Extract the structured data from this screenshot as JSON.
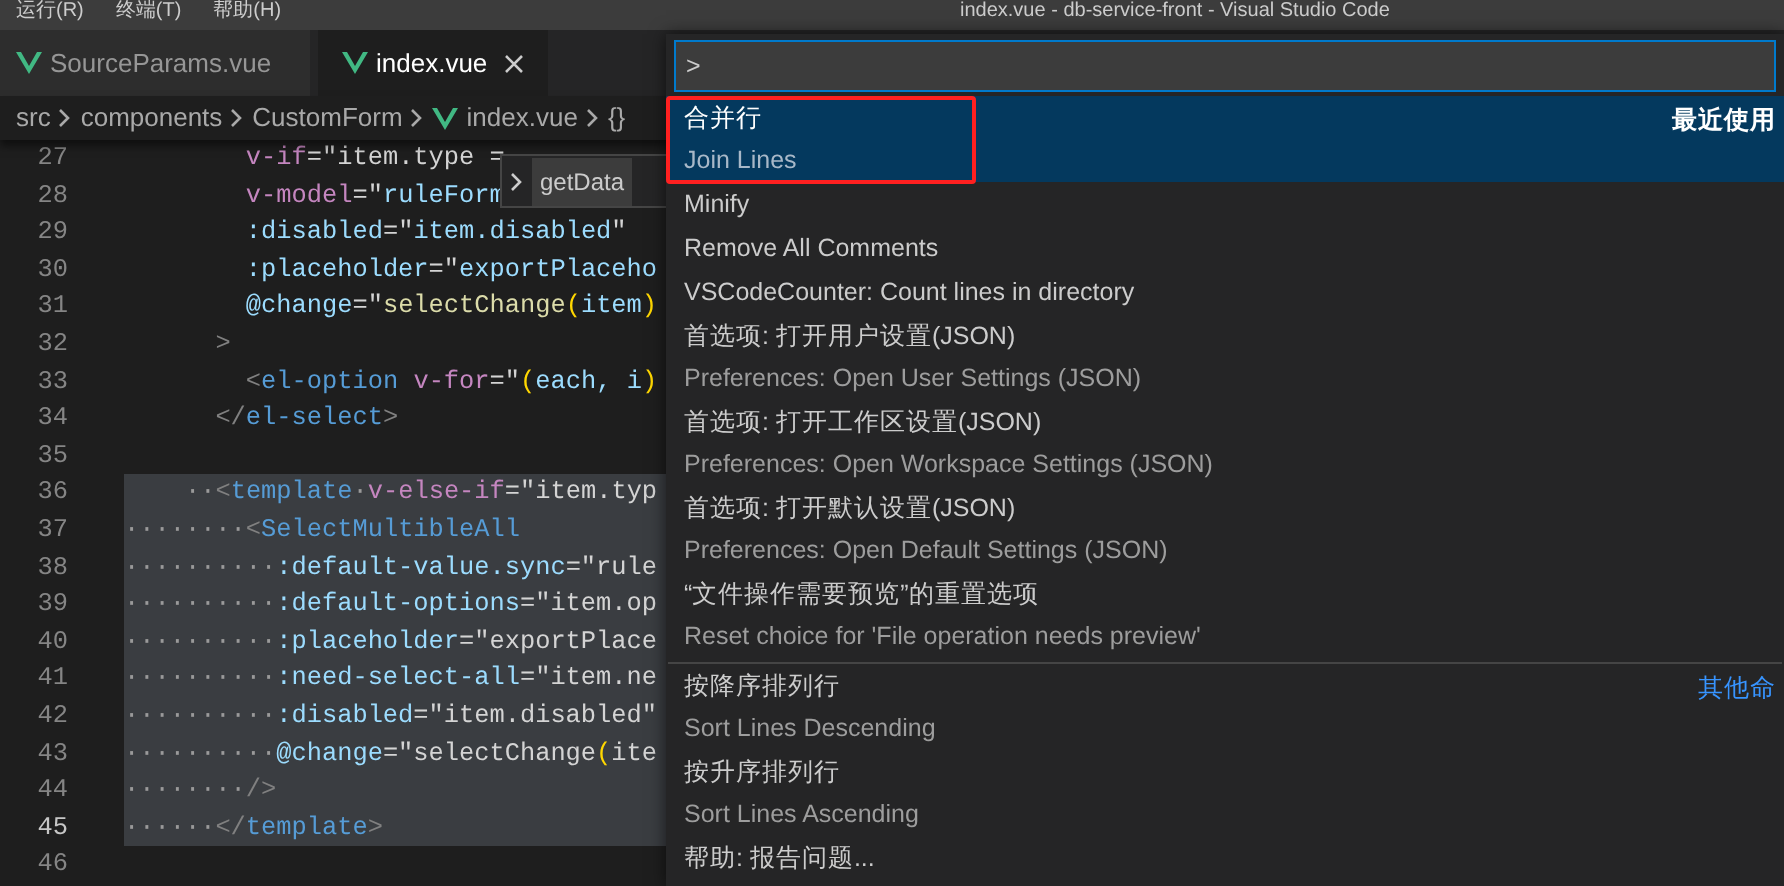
{
  "menu_bar": {
    "items": [
      "运行(R)",
      "终端(T)",
      "帮助(H)"
    ],
    "title": "index.vue - db-service-front - Visual Studio Code"
  },
  "tabs": [
    {
      "label": "SourceParams.vue",
      "selected": false
    },
    {
      "label": "index.vue",
      "selected": true
    }
  ],
  "breadcrumb": [
    {
      "label": "src",
      "kind": "folder"
    },
    {
      "label": "components",
      "kind": "folder"
    },
    {
      "label": "CustomForm",
      "kind": "folder"
    },
    {
      "label": "index.vue",
      "kind": "file"
    },
    {
      "label": "{}",
      "kind": "symbol"
    }
  ],
  "hover_widget": {
    "label": "getData"
  },
  "code_lines": [
    {
      "number": "27",
      "current": false,
      "selected": false,
      "tokens": [
        {
          "kind": "directive",
          "text": "        v-if"
        },
        {
          "kind": "plain",
          "text": "=\"item.type ="
        }
      ]
    },
    {
      "number": "28",
      "current": false,
      "selected": false,
      "tokens": [
        {
          "kind": "directive",
          "text": "        v-model"
        },
        {
          "kind": "plain",
          "text": "=\""
        },
        {
          "kind": "attr",
          "text": "ruleForm"
        }
      ]
    },
    {
      "number": "29",
      "current": false,
      "selected": false,
      "tokens": [
        {
          "kind": "attr",
          "text": "        :disabled"
        },
        {
          "kind": "plain",
          "text": "=\""
        },
        {
          "kind": "attr",
          "text": "item.disabled"
        },
        {
          "kind": "plain",
          "text": "\""
        }
      ]
    },
    {
      "number": "30",
      "current": false,
      "selected": false,
      "tokens": [
        {
          "kind": "attr",
          "text": "        :placeholder"
        },
        {
          "kind": "plain",
          "text": "=\""
        },
        {
          "kind": "attr",
          "text": "exportPlaceho"
        }
      ]
    },
    {
      "number": "31",
      "current": false,
      "selected": false,
      "tokens": [
        {
          "kind": "attr",
          "text": "        @change"
        },
        {
          "kind": "plain",
          "text": "=\""
        },
        {
          "kind": "func",
          "text": "selectChange"
        },
        {
          "kind": "bracket",
          "text": "("
        },
        {
          "kind": "attr",
          "text": "item"
        },
        {
          "kind": "bracket",
          "text": ")"
        }
      ]
    },
    {
      "number": "32",
      "current": false,
      "selected": false,
      "tokens": [
        {
          "kind": "punct",
          "text": "      >"
        }
      ]
    },
    {
      "number": "33",
      "current": false,
      "selected": false,
      "tokens": [
        {
          "kind": "punct",
          "text": "        <"
        },
        {
          "kind": "tag",
          "text": "el-option"
        },
        {
          "kind": "directive",
          "text": " v-for"
        },
        {
          "kind": "plain",
          "text": "=\""
        },
        {
          "kind": "bracket",
          "text": "("
        },
        {
          "kind": "attr",
          "text": "each, i"
        },
        {
          "kind": "bracket",
          "text": ")"
        }
      ]
    },
    {
      "number": "34",
      "current": false,
      "selected": false,
      "tokens": [
        {
          "kind": "punct",
          "text": "      </"
        },
        {
          "kind": "tag",
          "text": "el-select"
        },
        {
          "kind": "punct",
          "text": ">"
        }
      ]
    },
    {
      "number": "35",
      "current": false,
      "selected": false
    },
    {
      "number": "36",
      "current": false,
      "selected": true,
      "tokens": [
        {
          "kind": "punct",
          "text": "    ··<"
        },
        {
          "kind": "tag",
          "text": "template"
        },
        {
          "kind": "directive",
          "text": "·v-else-if"
        },
        {
          "kind": "plain",
          "text": "=\"item.typ"
        }
      ]
    },
    {
      "number": "37",
      "current": false,
      "selected": true,
      "tokens": [
        {
          "kind": "punct",
          "text": "········<"
        },
        {
          "kind": "tag",
          "text": "SelectMultibleAll"
        }
      ]
    },
    {
      "number": "38",
      "current": false,
      "selected": true,
      "tokens": [
        {
          "kind": "attr",
          "text": "··········:default-value.sync"
        },
        {
          "kind": "plain",
          "text": "=\"rule"
        }
      ]
    },
    {
      "number": "39",
      "current": false,
      "selected": true,
      "tokens": [
        {
          "kind": "attr",
          "text": "··········:default-options"
        },
        {
          "kind": "plain",
          "text": "=\"item.op"
        }
      ]
    },
    {
      "number": "40",
      "current": false,
      "selected": true,
      "tokens": [
        {
          "kind": "attr",
          "text": "··········:placeholder"
        },
        {
          "kind": "plain",
          "text": "=\"exportPlace"
        }
      ]
    },
    {
      "number": "41",
      "current": false,
      "selected": true,
      "tokens": [
        {
          "kind": "attr",
          "text": "··········:need-select-all"
        },
        {
          "kind": "plain",
          "text": "=\"item.ne"
        }
      ]
    },
    {
      "number": "42",
      "current": false,
      "selected": true,
      "tokens": [
        {
          "kind": "attr",
          "text": "··········:disabled"
        },
        {
          "kind": "plain",
          "text": "=\"item.disabled\""
        }
      ]
    },
    {
      "number": "43",
      "current": false,
      "selected": true,
      "tokens": [
        {
          "kind": "attr",
          "text": "··········@change"
        },
        {
          "kind": "plain",
          "text": "=\"selectChange"
        },
        {
          "kind": "bracket",
          "text": "("
        },
        {
          "kind": "plain",
          "text": "ite"
        }
      ]
    },
    {
      "number": "44",
      "current": false,
      "selected": true,
      "tokens": [
        {
          "kind": "punct",
          "text": "········/>"
        }
      ]
    },
    {
      "number": "45",
      "current": true,
      "selected": true,
      "tokens": [
        {
          "kind": "punct",
          "text": "······</"
        },
        {
          "kind": "tag",
          "text": "template"
        },
        {
          "kind": "punct",
          "text": ">"
        }
      ]
    },
    {
      "number": "46",
      "current": false,
      "selected": false
    }
  ],
  "command_palette": {
    "input_value": ">",
    "items": [
      {
        "kind": "double",
        "label": "合并行",
        "detail": "Join Lines",
        "badge": "最近使用",
        "badge_is_link": false,
        "selected": true,
        "highlighted": true,
        "separator_before": false
      },
      {
        "kind": "single",
        "label": "Minify",
        "selected": false,
        "highlighted": false,
        "separator_before": false
      },
      {
        "kind": "single",
        "label": "Remove All Comments",
        "selected": false,
        "highlighted": false,
        "separator_before": false
      },
      {
        "kind": "single",
        "label": "VSCodeCounter: Count lines in directory",
        "selected": false,
        "highlighted": false,
        "separator_before": false
      },
      {
        "kind": "double",
        "label": "首选项: 打开用户设置(JSON)",
        "detail": "Preferences: Open User Settings (JSON)",
        "selected": false,
        "highlighted": false,
        "separator_before": false
      },
      {
        "kind": "double",
        "label": "首选项: 打开工作区设置(JSON)",
        "detail": "Preferences: Open Workspace Settings (JSON)",
        "selected": false,
        "highlighted": false,
        "separator_before": false
      },
      {
        "kind": "double",
        "label": "首选项: 打开默认设置(JSON)",
        "detail": "Preferences: Open Default Settings (JSON)",
        "selected": false,
        "highlighted": false,
        "separator_before": false
      },
      {
        "kind": "double",
        "label": "“文件操作需要预览”的重置选项",
        "detail": "Reset choice for 'File operation needs preview'",
        "selected": false,
        "highlighted": false,
        "separator_before": false
      },
      {
        "kind": "double",
        "label": "按降序排列行",
        "detail": "Sort Lines Descending",
        "badge": "其他命",
        "badge_is_link": true,
        "selected": false,
        "highlighted": false,
        "separator_before": true
      },
      {
        "kind": "double",
        "label": "按升序排列行",
        "detail": "Sort Lines Ascending",
        "selected": false,
        "highlighted": false,
        "separator_before": false
      },
      {
        "kind": "single",
        "label": "帮助: 报告问题...",
        "selected": false,
        "highlighted": false,
        "separator_before": false
      }
    ]
  }
}
